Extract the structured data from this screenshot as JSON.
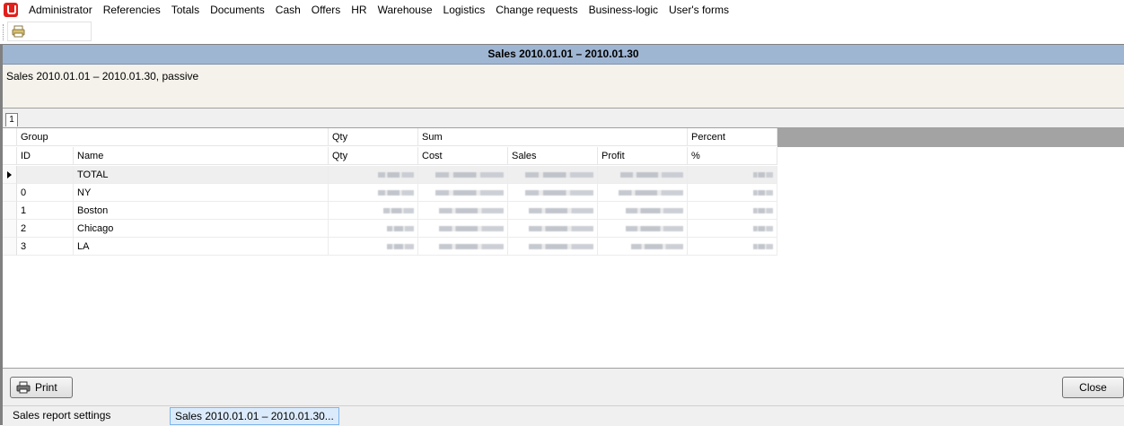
{
  "menu": {
    "items": [
      "Administrator",
      "Referencies",
      "Totals",
      "Documents",
      "Cash",
      "Offers",
      "HR",
      "Warehouse",
      "Logistics",
      "Change requests",
      "Business-logic",
      "User's forms"
    ]
  },
  "window": {
    "title": "Sales 2010.01.01 – 2010.01.30",
    "description": "Sales 2010.01.01 – 2010.01.30, passive",
    "page_tab": "1"
  },
  "grid": {
    "group_headers": {
      "group": "Group",
      "qty": "Qty",
      "sum": "Sum",
      "percent": "Percent"
    },
    "columns": {
      "id": "ID",
      "name": "Name",
      "qty": "Qty",
      "cost": "Cost",
      "sales": "Sales",
      "profit": "Profit",
      "pct": "%"
    },
    "rows": [
      {
        "id": "",
        "name": "TOTAL"
      },
      {
        "id": "0",
        "name": "NY"
      },
      {
        "id": "1",
        "name": "Boston"
      },
      {
        "id": "2",
        "name": "Chicago"
      },
      {
        "id": "3",
        "name": "LA"
      }
    ]
  },
  "buttons": {
    "print": "Print",
    "close": "Close"
  },
  "status": {
    "settings": "Sales report settings",
    "window": "Sales 2010.01.01 – 2010.01.30..."
  },
  "icons": {
    "print": "printer-icon",
    "logo": "app-logo-icon",
    "selector": "row-pointer-icon"
  }
}
